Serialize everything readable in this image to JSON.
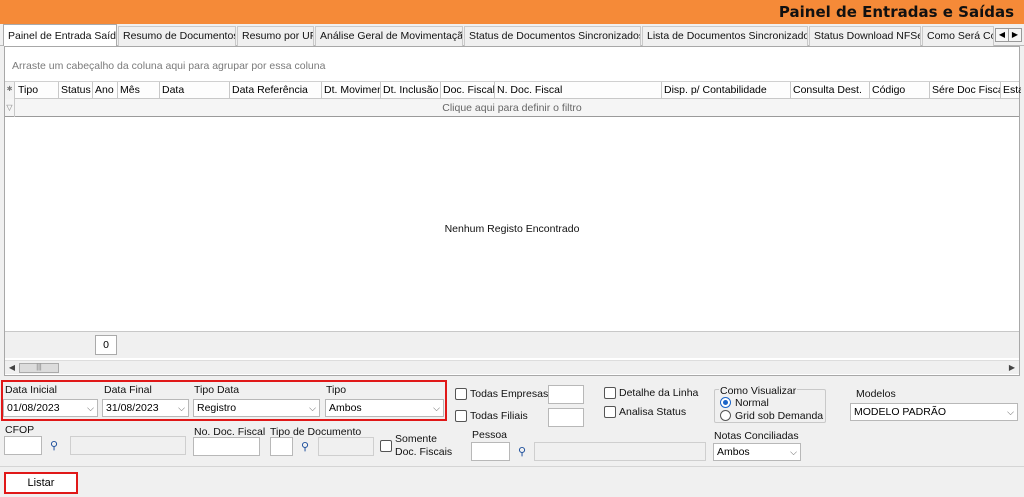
{
  "window": {
    "title": "Painel de Entradas e Saídas"
  },
  "tabs": [
    "Painel de Entrada Saída",
    "Resumo de Documentos",
    "Resumo por UF",
    "Análise Geral de Movimentação",
    "Status de Documentos Sincronizados",
    "Lista de Documentos Sincronizados",
    "Status Download NFSe",
    "Como Será Cor"
  ],
  "grid": {
    "group_hint": "Arraste um cabeçalho da coluna aqui para agrupar por essa coluna",
    "columns": [
      "Tipo",
      "Status",
      "Ano",
      "Mês",
      "Data",
      "Data Referência",
      "Dt. Movimen",
      "Dt. Inclusão",
      "Doc. Fiscal",
      "N. Doc. Fiscal",
      "Disp. p/ Contabilidade",
      "Consulta Dest.",
      "Código",
      "Sére Doc Fiscal",
      "Esta"
    ],
    "filter_hint": "Clique aqui para definir o filtro",
    "empty_message": "Nenhum Registo Encontrado",
    "record_count": "0"
  },
  "filters": {
    "data_inicial": {
      "label": "Data Inicial",
      "value": "01/08/2023"
    },
    "data_final": {
      "label": "Data Final",
      "value": "31/08/2023"
    },
    "tipo_data": {
      "label": "Tipo Data",
      "value": "Registro"
    },
    "tipo": {
      "label": "Tipo",
      "value": "Ambos"
    },
    "todas_empresas": "Todas Empresas",
    "todas_filiais": "Todas Filiais",
    "detalhe_linha": "Detalhe da Linha",
    "analisa_status": "Analisa Status",
    "como_visualizar": {
      "label": "Como Visualizar",
      "normal": "Normal",
      "grid": "Grid sob Demanda"
    },
    "modelos": {
      "label": "Modelos",
      "value": "MODELO PADRÃO"
    },
    "cfop": "CFOP",
    "no_doc_fiscal": "No. Doc. Fiscal",
    "tipo_documento": "Tipo de Documento",
    "somente_doc_fiscais": {
      "line1": "Somente",
      "line2": "Doc. Fiscais"
    },
    "pessoa": "Pessoa",
    "notas_conciliadas": {
      "label": "Notas Conciliadas",
      "value": "Ambos"
    }
  },
  "actions": {
    "listar": "Listar"
  }
}
